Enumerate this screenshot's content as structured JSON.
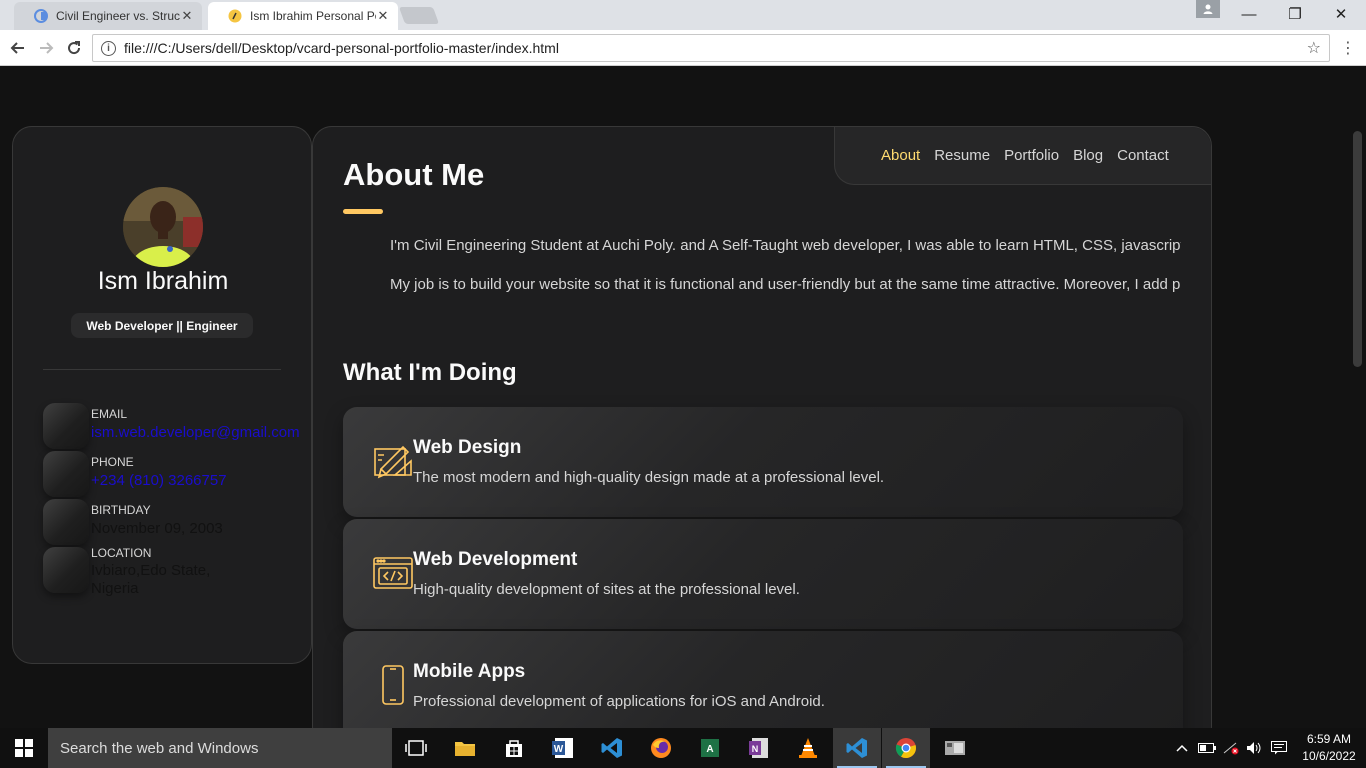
{
  "browser": {
    "tabs": [
      {
        "title": "Civil Engineer vs. Structur",
        "active": false
      },
      {
        "title": "Ism Ibrahim Personal Por",
        "active": true
      }
    ],
    "address": "file:///C:/Users/dell/Desktop/vcard-personal-portfolio-master/index.html",
    "window_controls": {
      "minimize": "—",
      "restore": "❐",
      "close": "✕"
    }
  },
  "sidebar": {
    "name": "Ism Ibrahim",
    "title": "Web Developer || Engineer",
    "contacts": [
      {
        "label": "EMAIL",
        "value": "ism.web.developer@gmail.com",
        "link": true
      },
      {
        "label": "PHONE",
        "value": "+234 (810) 3266757",
        "link": true
      },
      {
        "label": "BIRTHDAY",
        "value": "November 09, 2003",
        "link": false
      },
      {
        "label": "LOCATION",
        "value": "Ivbiaro,Edo State,",
        "value2": "Nigeria",
        "link": false
      }
    ]
  },
  "navbar": {
    "items": [
      {
        "label": "About",
        "active": true
      },
      {
        "label": "Resume",
        "active": false
      },
      {
        "label": "Portfolio",
        "active": false
      },
      {
        "label": "Blog",
        "active": false
      },
      {
        "label": "Contact",
        "active": false
      }
    ]
  },
  "about": {
    "heading": "About Me",
    "paragraphs": [
      "I'm Civil Engineering Student at Auchi Poly. and A Self-Taught web developer, I was able to learn HTML, CSS, javascript, F",
      "My job is to build your website so that it is functional and user-friendly but at the same time attractive. Moreover, I add perso"
    ]
  },
  "services": {
    "heading": "What I'm Doing",
    "items": [
      {
        "title": "Web Design",
        "text": "The most modern and high-quality design made at a professional level.",
        "icon": "design-icon"
      },
      {
        "title": "Web Development",
        "text": "High-quality development of sites at the professional level.",
        "icon": "code-icon"
      },
      {
        "title": "Mobile Apps",
        "text": "Professional development of applications for iOS and Android.",
        "icon": "phone-icon"
      }
    ]
  },
  "taskbar": {
    "search_placeholder": "Search the web and Windows",
    "time": "6:59 AM",
    "date": "10/6/2022"
  },
  "colors": {
    "accent": "#ffdb70",
    "underline": "#ffc862",
    "card_bg": "#1e1e1f",
    "page_bg": "#121212"
  }
}
